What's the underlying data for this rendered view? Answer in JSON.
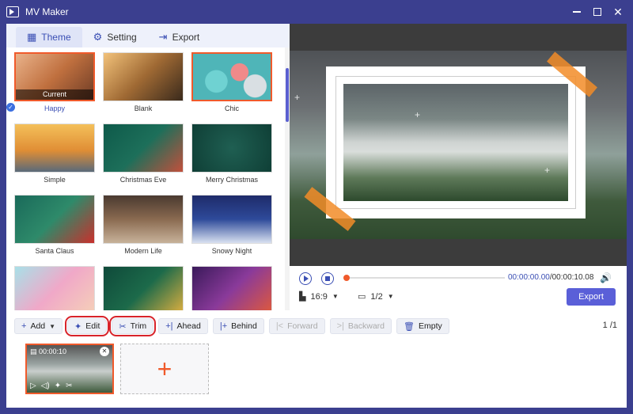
{
  "window": {
    "title": "MV Maker"
  },
  "tabs": [
    {
      "label": "Theme",
      "icon": "grid-icon"
    },
    {
      "label": "Setting",
      "icon": "gear-icon"
    },
    {
      "label": "Export",
      "icon": "export-icon"
    }
  ],
  "themes": [
    {
      "label": "Happy",
      "tag": "Current",
      "selected": true
    },
    {
      "label": "Blank"
    },
    {
      "label": "Chic"
    },
    {
      "label": "Simple"
    },
    {
      "label": "Christmas Eve"
    },
    {
      "label": "Merry Christmas"
    },
    {
      "label": "Santa Claus"
    },
    {
      "label": "Modern Life"
    },
    {
      "label": "Snowy Night"
    },
    {
      "label": ""
    },
    {
      "label": ""
    },
    {
      "label": ""
    }
  ],
  "player": {
    "current_time": "00:00:00.00",
    "total_time": "/00:00:10.08",
    "ratio": "16:9",
    "resolution": "1/2",
    "export_label": "Export"
  },
  "toolbar": {
    "add": "Add",
    "edit": "Edit",
    "trim": "Trim",
    "ahead": "Ahead",
    "behind": "Behind",
    "forward": "Forward",
    "backward": "Backward",
    "empty": "Empty"
  },
  "page_indicator": "1 /1",
  "clip": {
    "duration": "00:00:10"
  },
  "colors": {
    "accent": "#3b4fb4",
    "highlight": "#f05a2b",
    "title_bar": "#3b3f8f"
  }
}
